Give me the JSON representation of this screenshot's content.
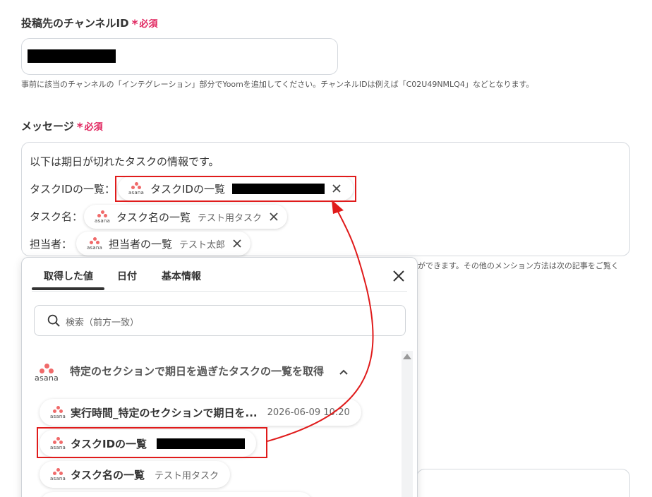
{
  "channel_field": {
    "label": "投稿先のチャンネルID",
    "required": "必須",
    "help": "事前に該当のチャンネルの「インテグレーション」部分でYoomを追加してください。チャンネルIDは例えば「C02U49NMLQ4」などとなります。"
  },
  "message_field": {
    "label": "メッセージ",
    "required": "必須",
    "intro": "以下は期日が切れたタスクの情報です。",
    "rows": [
      {
        "prefix": "タスクIDの一覧：",
        "chip_title": "タスクIDの一覧",
        "chip_value": ""
      },
      {
        "prefix": "タスク名：",
        "chip_title": "タスク名の一覧",
        "chip_value": "テスト用タスク"
      },
      {
        "prefix": "担当者：",
        "chip_title": "担当者の一覧",
        "chip_value": "テスト太郎"
      }
    ],
    "help_tail": "ができます。その他のメンション方法は次の記事をご覧く"
  },
  "panel": {
    "tabs": [
      "取得した値",
      "日付",
      "基本情報"
    ],
    "active_tab": "取得した値",
    "search_placeholder": "検索（前方一致）",
    "group_title": "特定のセクションで期日を過ぎたタスクの一覧を取得",
    "items": [
      {
        "title": "実行時間_特定のセクションで期日を...",
        "value": "2026-06-09 10:20"
      },
      {
        "title": "タスクIDの一覧",
        "value": ""
      },
      {
        "title": "タスク名の一覧",
        "value": "テスト用タスク"
      }
    ]
  },
  "icons": {
    "app": "asana-logo",
    "app_label": "asana",
    "close": "close-icon",
    "search": "search-icon",
    "collapse": "chevron-up-icon"
  },
  "colors": {
    "required": "#e0245e",
    "annotation": "#e01b1b",
    "asana": "#f06a6a"
  }
}
